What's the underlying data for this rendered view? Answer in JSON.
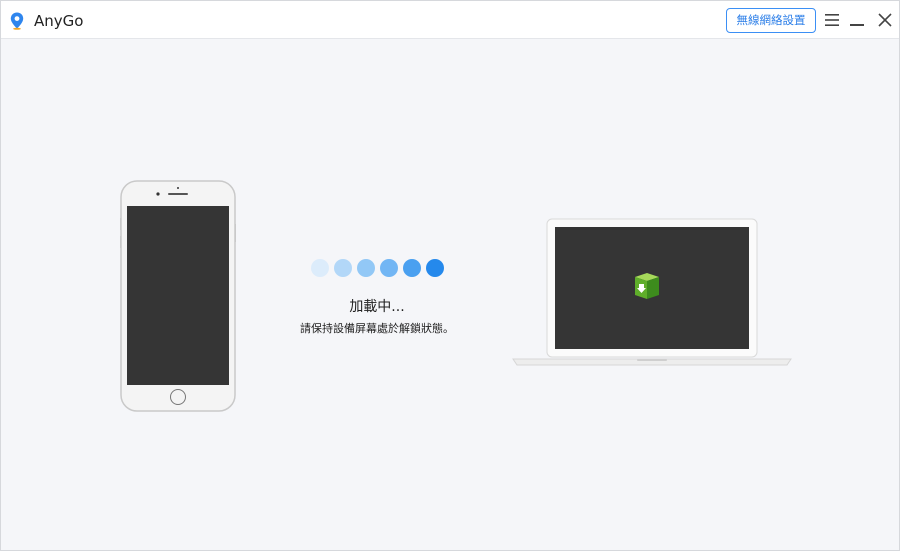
{
  "app": {
    "title": "AnyGo"
  },
  "titlebar": {
    "wifi_settings_label": "無線網絡設置",
    "menu_icon": "hamburger-menu-icon",
    "minimize_icon": "minimize-icon",
    "close_icon": "close-icon"
  },
  "main": {
    "loading_text": "加載中...",
    "hint_text": "請保持設備屏幕處於解鎖狀態。",
    "progress_dots": [
      {
        "color": "#dcecfb"
      },
      {
        "color": "#b2d7f8"
      },
      {
        "color": "#92c8f6"
      },
      {
        "color": "#72b6f4"
      },
      {
        "color": "#4aa0f0"
      },
      {
        "color": "#2589ec"
      }
    ],
    "phone_icon": "iphone-device-icon",
    "laptop_icon": "laptop-computer-icon",
    "box_icon": "green-download-box-icon"
  },
  "colors": {
    "accent": "#3b8ff5",
    "background": "#f5f6f9",
    "screen": "#353535"
  }
}
